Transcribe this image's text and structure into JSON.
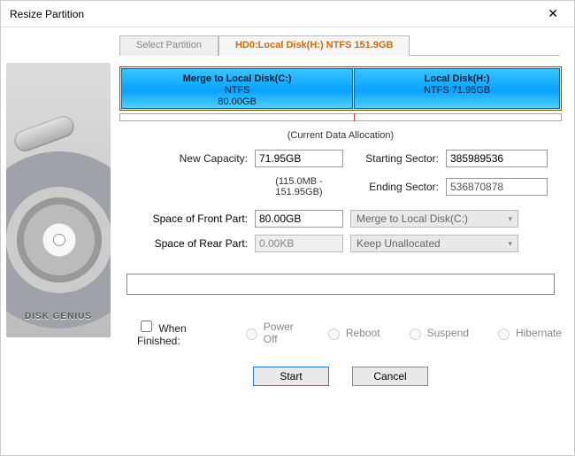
{
  "window": {
    "title": "Resize Partition"
  },
  "tabs": {
    "select_label": "Select Partition",
    "active_label": "HD0:Local Disk(H:) NTFS 151.9GB"
  },
  "partitions": [
    {
      "name": "Merge to Local Disk(C:)",
      "fs": "NTFS",
      "size": "80.00GB",
      "width_pct": 53
    },
    {
      "name": "Local Disk(H:)",
      "fs": "NTFS 71.95GB",
      "size": "",
      "width_pct": 47
    }
  ],
  "allocation_label": "(Current Data Allocation)",
  "fields": {
    "new_capacity": {
      "label": "New Capacity:",
      "value": "71.95GB"
    },
    "range_note": "(115.0MB - 151.95GB)",
    "starting_sector": {
      "label": "Starting Sector:",
      "value": "385989536"
    },
    "ending_sector": {
      "label": "Ending Sector:",
      "value": "536870878"
    },
    "front_part": {
      "label": "Space of Front Part:",
      "value": "80.00GB",
      "combo": "Merge to Local Disk(C:)"
    },
    "rear_part": {
      "label": "Space of Rear Part:",
      "value": "0.00KB",
      "combo": "Keep Unallocated"
    }
  },
  "when_finished": {
    "label": "When Finished:",
    "options": [
      "Power Off",
      "Reboot",
      "Suspend",
      "Hibernate"
    ]
  },
  "buttons": {
    "start": "Start",
    "cancel": "Cancel"
  },
  "sidebar_brand": "DISK GENIUS"
}
